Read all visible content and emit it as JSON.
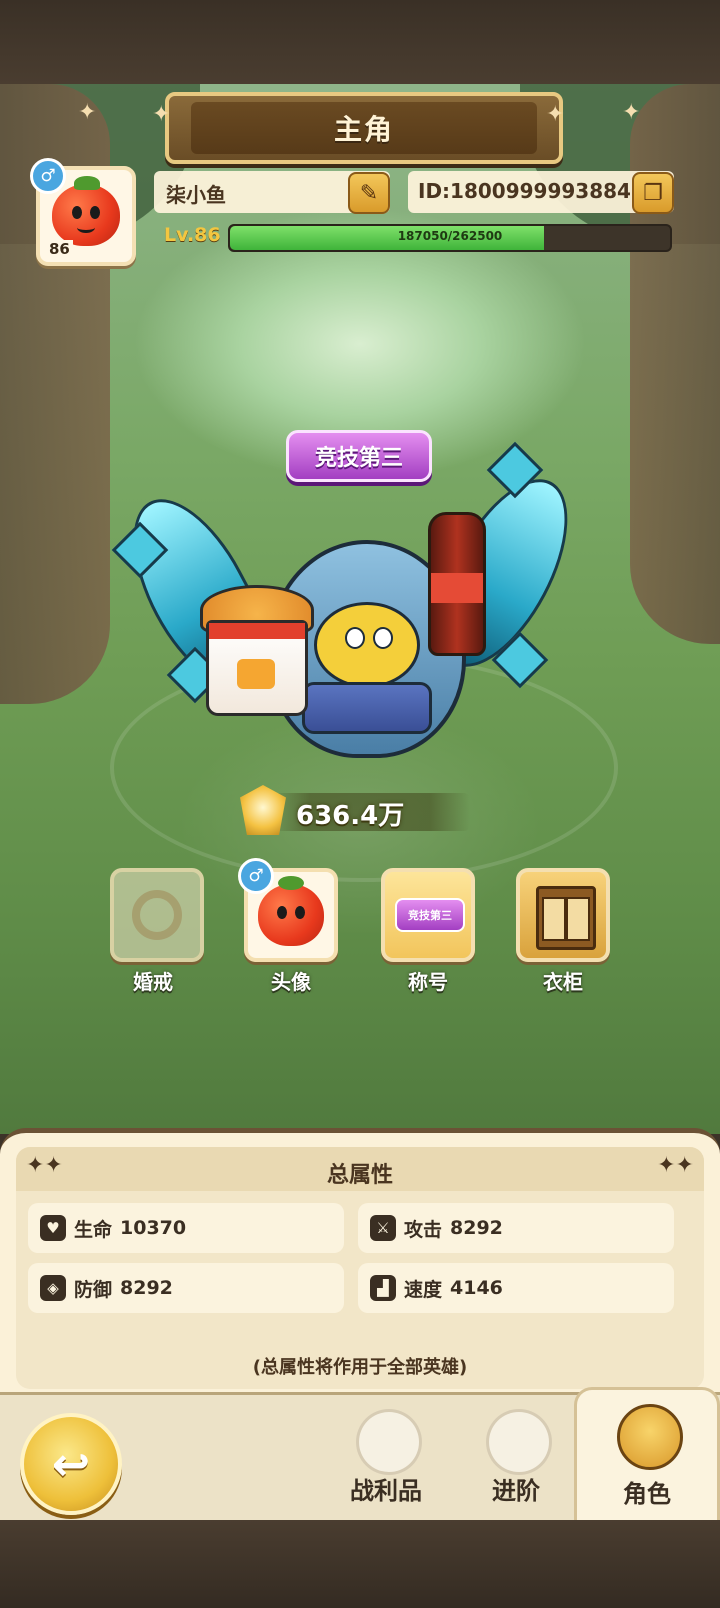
{
  "header": {
    "title": "主角"
  },
  "profile": {
    "name": "柒小鱼",
    "id_text": "ID:1800999993884",
    "level_label": "Lv.86",
    "avatar_level": "86",
    "gender_symbol": "♂",
    "xp_text": "187050/262500",
    "xp_fraction": 0.7126
  },
  "character": {
    "title_badge": "竞技第三",
    "power": "636.4万"
  },
  "slots": [
    {
      "label": "婚戒"
    },
    {
      "label": "头像"
    },
    {
      "label": "称号"
    },
    {
      "label": "衣柜"
    }
  ],
  "attributes": {
    "title": "总属性",
    "stats": [
      {
        "label": "生命",
        "value": "10370",
        "icon": "heart-icon"
      },
      {
        "label": "攻击",
        "value": "8292",
        "icon": "sword-icon"
      },
      {
        "label": "防御",
        "value": "8292",
        "icon": "shield-icon"
      },
      {
        "label": "速度",
        "value": "4146",
        "icon": "boot-icon"
      }
    ],
    "note": "(总属性将作用于全部英雄)"
  },
  "nav": {
    "tabs": [
      {
        "label": "战利品"
      },
      {
        "label": "进阶"
      },
      {
        "label": "角色"
      }
    ],
    "active": "角色"
  },
  "colors": {
    "accent_gold": "#f3c640",
    "xp_green": "#3fb43a",
    "badge_purple": "#a33fc2"
  }
}
